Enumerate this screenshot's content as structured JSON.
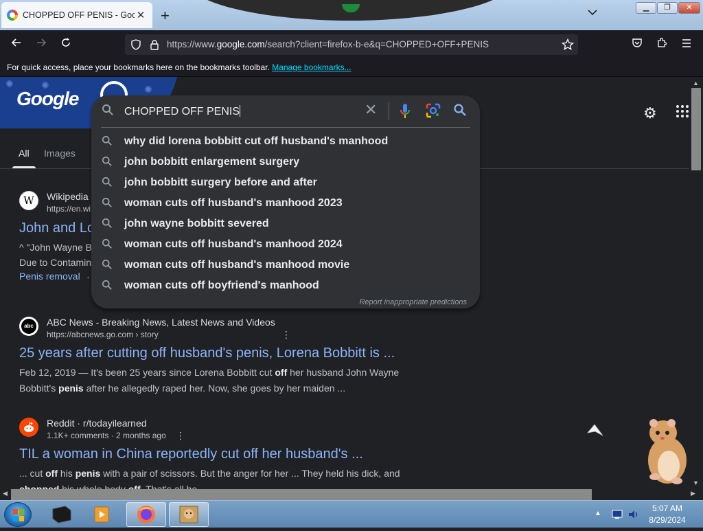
{
  "browser": {
    "tab_title": "CHOPPED OFF PENIS - Google",
    "new_tab_glyph": "+",
    "url_prefix": "https://www.",
    "url_host": "google.com",
    "url_rest": "/search?client=firefox-b-e&q=CHOPPED+OFF+PENIS"
  },
  "bookmarks_bar": {
    "message": "For quick access, place your bookmarks here on the bookmarks toolbar.",
    "link": "Manage bookmarks..."
  },
  "google": {
    "logo_text": "Google",
    "tabs": [
      "All",
      "Images"
    ],
    "search": {
      "query": "CHOPPED OFF PENIS",
      "suggestions": [
        "why did lorena bobbitt cut off husband's manhood",
        "john bobbitt enlargement surgery",
        "john bobbitt surgery before and after",
        "woman cuts off husband's manhood 2023",
        "john wayne bobbitt severed",
        "woman cuts off husband's manhood 2024",
        "woman cuts off husband's manhood movie",
        "woman cuts off boyfriend's manhood"
      ],
      "report": "Report inappropriate predictions"
    },
    "results": [
      {
        "site": "Wikipedia",
        "url": "https://en.wi",
        "title": "John and Lo",
        "snippet1": "^ \"John Wayne B",
        "snippet2": "Due to Contamin",
        "link": "Penis removal",
        "link_tail": "· J"
      },
      {
        "site": "ABC News - Breaking News, Latest News and Videos",
        "url": "https://abcnews.go.com › story",
        "title": "25 years after cutting off husband's penis, Lorena Bobbitt is ...",
        "snippet1_a": "Feb 12, 2019 — It's been 25 years since Lorena Bobbitt cut ",
        "snippet1_b": "off",
        "snippet1_c": " her husband John Wayne",
        "snippet2_a": "Bobbitt's ",
        "snippet2_b": "penis",
        "snippet2_c": " after he allegedly raped her. Now, she goes by her maiden ..."
      },
      {
        "site": "Reddit · r/todayilearned",
        "url": "1.1K+ comments · 2 months ago",
        "title": "TIL a woman in China reportedly cut off her husband's ...",
        "snippet1_a": "... cut ",
        "snippet1_b": "off",
        "snippet1_c": " his ",
        "snippet1_d": "penis",
        "snippet1_e": " with a pair of scissors. But the anger for her ... They held his dick, and",
        "snippet2_a": "chopped",
        "snippet2_b": " his whole body ",
        "snippet2_c": "off",
        "snippet2_d": ". That's all he"
      }
    ]
  },
  "taskbar": {
    "time": "5:07 AM",
    "date": "8/29/2024"
  },
  "colors": {
    "page_bg": "#202124",
    "link_blue": "#8ab4f8",
    "dropdown_bg": "#303134",
    "firefox_chrome": "#1c1b22"
  }
}
